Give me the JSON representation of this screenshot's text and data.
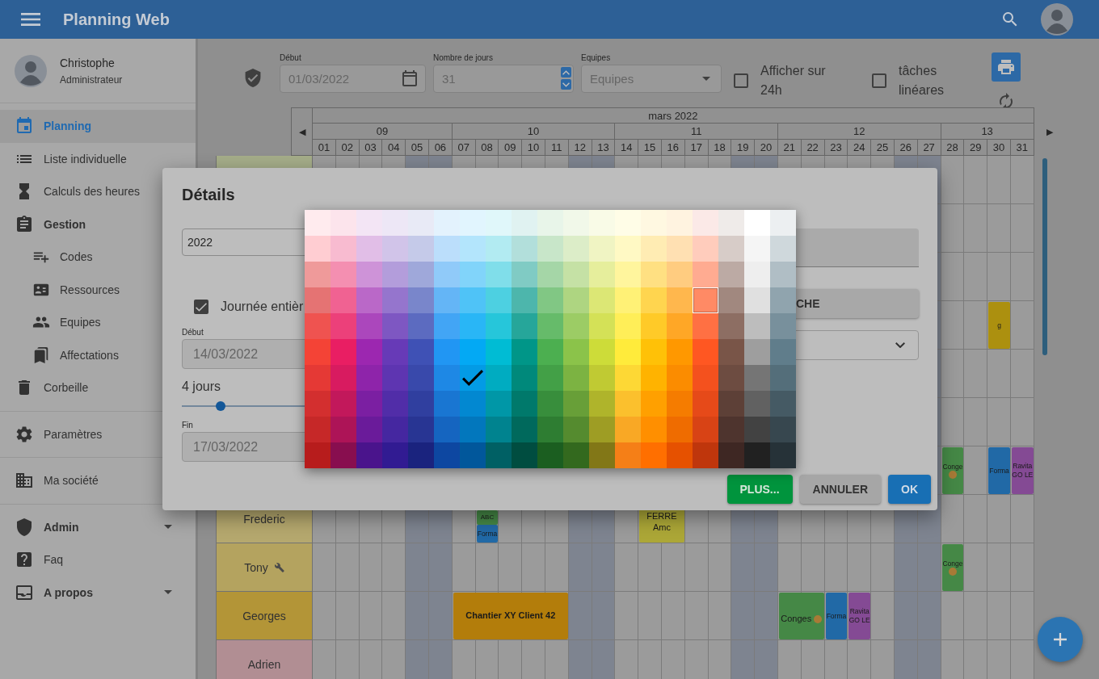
{
  "app_bar": {
    "title": "Planning Web"
  },
  "user": {
    "name": "Christophe",
    "role": "Administrateur"
  },
  "sidebar": {
    "sections": [
      {
        "items": [
          {
            "label": "Planning",
            "kind": "item",
            "selected": true
          },
          {
            "label": "Liste individuelle",
            "kind": "item",
            "selected": false
          },
          {
            "label": "Calculs des heures",
            "kind": "item",
            "selected": false
          },
          {
            "label": "Gestion",
            "kind": "group",
            "selected": false,
            "children": [
              {
                "label": "Codes",
                "kind": "item",
                "selected": false
              },
              {
                "label": "Ressources",
                "kind": "item",
                "selected": false
              },
              {
                "label": "Equipes",
                "kind": "item",
                "selected": false
              },
              {
                "label": "Affectations",
                "kind": "item",
                "selected": false
              }
            ]
          },
          {
            "label": "Corbeille",
            "kind": "item",
            "selected": false
          }
        ]
      },
      {
        "items": [
          {
            "label": "Paramètres",
            "kind": "item",
            "selected": false
          }
        ]
      },
      {
        "items": [
          {
            "label": "Ma société",
            "kind": "item",
            "selected": false
          }
        ]
      },
      {
        "items": [
          {
            "label": "Admin",
            "kind": "menu",
            "selected": false,
            "expanded": false
          },
          {
            "label": "Faq",
            "kind": "item",
            "selected": false
          },
          {
            "label": "A propos",
            "kind": "menu",
            "selected": false,
            "expanded": false
          }
        ]
      }
    ]
  },
  "toolbar": {
    "start_label": "Début",
    "start_value": "01/03/2022",
    "days_label": "Nombre de jours",
    "days_value": "31",
    "teams_label": "Equipes",
    "teams_placeholder": "Equipes",
    "checkboxes": [
      {
        "label": "Afficher sur 24h",
        "checked": false
      },
      {
        "label": "tâches linéares",
        "checked": false
      }
    ]
  },
  "calendar": {
    "month": "mars 2022",
    "prev": "◀",
    "next": "▶",
    "weeks": [
      {
        "label": "09",
        "days": [
          {
            "label": "01",
            "weekend": false
          },
          {
            "label": "02",
            "weekend": false
          },
          {
            "label": "03",
            "weekend": false
          },
          {
            "label": "04",
            "weekend": false
          },
          {
            "label": "05",
            "weekend": true
          },
          {
            "label": "06",
            "weekend": true
          }
        ]
      },
      {
        "label": "10",
        "days": [
          {
            "label": "07",
            "weekend": false
          },
          {
            "label": "08",
            "weekend": false
          },
          {
            "label": "09",
            "weekend": false
          },
          {
            "label": "10",
            "weekend": false
          },
          {
            "label": "11",
            "weekend": false
          },
          {
            "label": "12",
            "weekend": true
          },
          {
            "label": "13",
            "weekend": true
          }
        ]
      },
      {
        "label": "11",
        "days": [
          {
            "label": "14",
            "weekend": false
          },
          {
            "label": "15",
            "weekend": false
          },
          {
            "label": "16",
            "weekend": false
          },
          {
            "label": "17",
            "weekend": false
          },
          {
            "label": "18",
            "weekend": false
          },
          {
            "label": "19",
            "weekend": true
          },
          {
            "label": "20",
            "weekend": true
          }
        ]
      },
      {
        "label": "12",
        "days": [
          {
            "label": "21",
            "weekend": false
          },
          {
            "label": "22",
            "weekend": false
          },
          {
            "label": "23",
            "weekend": false
          },
          {
            "label": "24",
            "weekend": false
          },
          {
            "label": "25",
            "weekend": false
          },
          {
            "label": "26",
            "weekend": true
          },
          {
            "label": "27",
            "weekend": true
          }
        ]
      },
      {
        "label": "13",
        "days": [
          {
            "label": "28",
            "weekend": false
          },
          {
            "label": "29",
            "weekend": false
          },
          {
            "label": "30",
            "weekend": false
          },
          {
            "label": "31",
            "weekend": false
          }
        ]
      }
    ],
    "rows": [
      {
        "color": "#a5ad89"
      },
      {},
      {},
      {
        "timeline": [
          {
            "kind": "empty"
          },
          {
            "kind": "empty"
          },
          {
            "kind": "empty"
          },
          {
            "kind": "empty"
          },
          {
            "kind": "empty"
          },
          {
            "kind": "empty"
          },
          {
            "kind": "empty"
          },
          {
            "kind": "empty"
          },
          {
            "kind": "empty"
          },
          {
            "kind": "empty"
          },
          {
            "kind": "empty"
          },
          {
            "kind": "empty"
          },
          {
            "kind": "empty"
          },
          {
            "kind": "empty"
          },
          {
            "kind": "empty"
          },
          {
            "kind": "empty"
          },
          {
            "kind": "empty"
          },
          {
            "kind": "empty"
          },
          {
            "kind": "empty"
          },
          {
            "kind": "empty"
          },
          {
            "kind": "empty"
          },
          {
            "kind": "empty"
          },
          {
            "kind": "empty"
          },
          {
            "kind": "empty"
          },
          {
            "kind": "empty"
          },
          {
            "kind": "empty"
          },
          {
            "kind": "empty"
          },
          {
            "kind": "empty"
          },
          {
            "kind": "empty"
          },
          {
            "kind": "event",
            "text": "g",
            "color": "#ac900f",
            "emoji": false
          }
        ]
      },
      {},
      {},
      {
        "timeline": [
          {
            "kind": "empty"
          },
          {
            "kind": "empty"
          },
          {
            "kind": "empty"
          },
          {
            "kind": "empty"
          },
          {
            "kind": "empty"
          },
          {
            "kind": "empty"
          },
          {
            "kind": "empty"
          },
          {
            "kind": "empty"
          },
          {
            "kind": "empty"
          },
          {
            "kind": "empty"
          },
          {
            "kind": "empty"
          },
          {
            "kind": "empty"
          },
          {
            "kind": "empty"
          },
          {
            "kind": "empty"
          },
          {
            "kind": "empty"
          },
          {
            "kind": "empty"
          },
          {
            "kind": "empty"
          },
          {
            "kind": "empty"
          },
          {
            "kind": "empty"
          },
          {
            "kind": "empty"
          },
          {
            "kind": "empty"
          },
          {
            "kind": "empty"
          },
          {
            "kind": "empty"
          },
          {
            "kind": "empty"
          },
          {
            "kind": "empty"
          },
          {
            "kind": "empty"
          },
          {
            "kind": "empty"
          },
          {
            "kind": "event",
            "text": "Conge",
            "color": "#458846",
            "emoji": true
          },
          {
            "kind": "empty"
          },
          {
            "kind": "event",
            "text": "Forma",
            "color": "#2169a6",
            "emoji": false
          },
          {
            "kind": "event",
            "text": "Ravita GO LE",
            "color": "#844a94",
            "emoji": false
          }
        ]
      },
      {
        "name": "Frederic",
        "color": "#b5a86e",
        "has_icon": false,
        "timeline": [
          {
            "kind": "empty"
          },
          {
            "kind": "empty"
          },
          {
            "kind": "empty"
          },
          {
            "kind": "empty"
          },
          {
            "kind": "empty"
          },
          {
            "kind": "empty"
          },
          {
            "kind": "empty"
          },
          {
            "kind": "stack",
            "events": [
              {
                "text": "ABC",
                "color": "#458846",
                "emoji": false
              },
              {
                "text": "Forma",
                "color": "#2169a6",
                "emoji": false
              }
            ]
          },
          {
            "kind": "empty"
          },
          {
            "kind": "empty"
          },
          {
            "kind": "empty"
          },
          {
            "kind": "empty"
          },
          {
            "kind": "empty"
          },
          {
            "kind": "empty"
          },
          {
            "kind": "event",
            "text": "FERRE Amc",
            "color": "#aca737",
            "emoji": false
          },
          {
            "kind": "continued"
          }
        ]
      },
      {
        "name": "Tony",
        "color": "#b4a35f",
        "has_icon": true,
        "timeline": [
          {
            "kind": "empty"
          },
          {
            "kind": "empty"
          },
          {
            "kind": "empty"
          },
          {
            "kind": "empty"
          },
          {
            "kind": "empty"
          },
          {
            "kind": "empty"
          },
          {
            "kind": "empty"
          },
          {
            "kind": "empty"
          },
          {
            "kind": "empty"
          },
          {
            "kind": "empty"
          },
          {
            "kind": "empty"
          },
          {
            "kind": "empty"
          },
          {
            "kind": "empty"
          },
          {
            "kind": "empty"
          },
          {
            "kind": "empty"
          },
          {
            "kind": "empty"
          },
          {
            "kind": "empty"
          },
          {
            "kind": "empty"
          },
          {
            "kind": "empty"
          },
          {
            "kind": "empty"
          },
          {
            "kind": "empty"
          },
          {
            "kind": "empty"
          },
          {
            "kind": "empty"
          },
          {
            "kind": "empty"
          },
          {
            "kind": "empty"
          },
          {
            "kind": "empty"
          },
          {
            "kind": "empty"
          },
          {
            "kind": "event",
            "text": "Conge",
            "color": "#458846",
            "emoji": true
          }
        ]
      },
      {
        "name": "Georges",
        "color": "#b39537",
        "has_icon": false,
        "timeline": [
          {
            "kind": "empty"
          },
          {
            "kind": "empty"
          },
          {
            "kind": "empty"
          },
          {
            "kind": "empty"
          },
          {
            "kind": "empty"
          },
          {
            "kind": "empty"
          },
          {
            "kind": "event",
            "text": "Chantier XY Client 42",
            "color": "#b37d0b",
            "emoji": false
          },
          {
            "kind": "continued"
          },
          {
            "kind": "continued"
          },
          {
            "kind": "continued"
          },
          {
            "kind": "continued"
          },
          {
            "kind": "empty"
          },
          {
            "kind": "empty"
          },
          {
            "kind": "empty"
          },
          {
            "kind": "empty"
          },
          {
            "kind": "empty"
          },
          {
            "kind": "empty"
          },
          {
            "kind": "empty"
          },
          {
            "kind": "empty"
          },
          {
            "kind": "empty"
          },
          {
            "kind": "event",
            "text": "Conges",
            "color": "#458846",
            "emoji": true
          },
          {
            "kind": "continued"
          },
          {
            "kind": "event",
            "text": "Forma",
            "color": "#2169a6",
            "emoji": false
          },
          {
            "kind": "event",
            "text": "Ravita GO LE",
            "color": "#844a94",
            "emoji": false
          }
        ]
      },
      {
        "name": "Adrien",
        "color": "#b18e93",
        "has_icon": false
      }
    ]
  },
  "dialog": {
    "title": "Détails",
    "name_value": "2022",
    "all_day": {
      "label": "Journée entièr",
      "checked": true
    },
    "start_label": "Début",
    "start_value": "14/03/2022",
    "duration": {
      "label": "4 jours",
      "level": 0.12
    },
    "end_label": "Fin",
    "end_value": "17/03/2022",
    "side_button": "CHE",
    "buttons": [
      {
        "label": "PLUS...",
        "kind": "more"
      },
      {
        "label": "ANNULER",
        "kind": "cancel"
      },
      {
        "label": "OK",
        "kind": "ok"
      }
    ]
  },
  "palette": {
    "rows": [
      {
        "swatches": [
          {
            "color": "#ffebee",
            "selected": false,
            "hovered": false
          },
          {
            "color": "#fce4ec",
            "selected": false,
            "hovered": false
          },
          {
            "color": "#f3e5f5",
            "selected": false,
            "hovered": false
          },
          {
            "color": "#ede7f6",
            "selected": false,
            "hovered": false
          },
          {
            "color": "#e8eaf6",
            "selected": false,
            "hovered": false
          },
          {
            "color": "#e3f2fd",
            "selected": false,
            "hovered": false
          },
          {
            "color": "#e1f5fe",
            "selected": false,
            "hovered": false
          },
          {
            "color": "#e0f7fa",
            "selected": false,
            "hovered": false
          },
          {
            "color": "#e0f2f1",
            "selected": false,
            "hovered": false
          },
          {
            "color": "#e8f5e9",
            "selected": false,
            "hovered": false
          },
          {
            "color": "#f1f8e9",
            "selected": false,
            "hovered": false
          },
          {
            "color": "#f9fbe7",
            "selected": false,
            "hovered": false
          },
          {
            "color": "#fffde7",
            "selected": false,
            "hovered": false
          },
          {
            "color": "#fff8e1",
            "selected": false,
            "hovered": false
          },
          {
            "color": "#fff3e0",
            "selected": false,
            "hovered": false
          },
          {
            "color": "#fbe9e7",
            "selected": false,
            "hovered": false
          },
          {
            "color": "#efebe9",
            "selected": false,
            "hovered": false
          },
          {
            "color": "#ffffff",
            "selected": false,
            "hovered": false
          },
          {
            "color": "#eceff1",
            "selected": false,
            "hovered": false
          }
        ]
      },
      {
        "swatches": [
          {
            "color": "#ffcdd2",
            "selected": false,
            "hovered": false
          },
          {
            "color": "#f8bbd0",
            "selected": false,
            "hovered": false
          },
          {
            "color": "#e1bee7",
            "selected": false,
            "hovered": false
          },
          {
            "color": "#d1c4e9",
            "selected": false,
            "hovered": false
          },
          {
            "color": "#c5cae9",
            "selected": false,
            "hovered": false
          },
          {
            "color": "#bbdefb",
            "selected": false,
            "hovered": false
          },
          {
            "color": "#b3e5fc",
            "selected": false,
            "hovered": false
          },
          {
            "color": "#b2ebf2",
            "selected": false,
            "hovered": false
          },
          {
            "color": "#b2dfdb",
            "selected": false,
            "hovered": false
          },
          {
            "color": "#c8e6c9",
            "selected": false,
            "hovered": false
          },
          {
            "color": "#dcedc8",
            "selected": false,
            "hovered": false
          },
          {
            "color": "#f0f4c3",
            "selected": false,
            "hovered": false
          },
          {
            "color": "#fff9c4",
            "selected": false,
            "hovered": false
          },
          {
            "color": "#ffecb3",
            "selected": false,
            "hovered": false
          },
          {
            "color": "#ffe0b2",
            "selected": false,
            "hovered": false
          },
          {
            "color": "#ffccbc",
            "selected": false,
            "hovered": false
          },
          {
            "color": "#d7ccc8",
            "selected": false,
            "hovered": false
          },
          {
            "color": "#f5f5f5",
            "selected": false,
            "hovered": false
          },
          {
            "color": "#cfd8dc",
            "selected": false,
            "hovered": false
          }
        ]
      },
      {
        "swatches": [
          {
            "color": "#ef9a9a",
            "selected": false,
            "hovered": false
          },
          {
            "color": "#f48fb1",
            "selected": false,
            "hovered": false
          },
          {
            "color": "#ce93d8",
            "selected": false,
            "hovered": false
          },
          {
            "color": "#b39ddb",
            "selected": false,
            "hovered": false
          },
          {
            "color": "#9fa8da",
            "selected": false,
            "hovered": false
          },
          {
            "color": "#90caf9",
            "selected": false,
            "hovered": false
          },
          {
            "color": "#81d4fa",
            "selected": false,
            "hovered": false
          },
          {
            "color": "#80deea",
            "selected": false,
            "hovered": false
          },
          {
            "color": "#80cbc4",
            "selected": false,
            "hovered": false
          },
          {
            "color": "#a5d6a7",
            "selected": false,
            "hovered": false
          },
          {
            "color": "#c5e1a5",
            "selected": false,
            "hovered": false
          },
          {
            "color": "#e6ee9c",
            "selected": false,
            "hovered": false
          },
          {
            "color": "#fff59d",
            "selected": false,
            "hovered": false
          },
          {
            "color": "#ffe082",
            "selected": false,
            "hovered": false
          },
          {
            "color": "#ffcc80",
            "selected": false,
            "hovered": false
          },
          {
            "color": "#ffab91",
            "selected": false,
            "hovered": false
          },
          {
            "color": "#bcaaa4",
            "selected": false,
            "hovered": false
          },
          {
            "color": "#eeeeee",
            "selected": false,
            "hovered": false
          },
          {
            "color": "#b0bec5",
            "selected": false,
            "hovered": false
          }
        ]
      },
      {
        "swatches": [
          {
            "color": "#e57373",
            "selected": false,
            "hovered": false
          },
          {
            "color": "#f06292",
            "selected": false,
            "hovered": false
          },
          {
            "color": "#ba68c8",
            "selected": false,
            "hovered": false
          },
          {
            "color": "#9575cd",
            "selected": false,
            "hovered": false
          },
          {
            "color": "#7986cb",
            "selected": false,
            "hovered": false
          },
          {
            "color": "#64b5f6",
            "selected": false,
            "hovered": false
          },
          {
            "color": "#4fc3f7",
            "selected": false,
            "hovered": false
          },
          {
            "color": "#4dd0e1",
            "selected": false,
            "hovered": false
          },
          {
            "color": "#4db6ac",
            "selected": false,
            "hovered": false
          },
          {
            "color": "#81c784",
            "selected": false,
            "hovered": false
          },
          {
            "color": "#aed581",
            "selected": false,
            "hovered": false
          },
          {
            "color": "#dce775",
            "selected": false,
            "hovered": false
          },
          {
            "color": "#fff176",
            "selected": false,
            "hovered": false
          },
          {
            "color": "#ffd54f",
            "selected": false,
            "hovered": false
          },
          {
            "color": "#ffb74d",
            "selected": false,
            "hovered": false
          },
          {
            "color": "#ff8a65",
            "selected": false,
            "hovered": true
          },
          {
            "color": "#a1887f",
            "selected": false,
            "hovered": false
          },
          {
            "color": "#e0e0e0",
            "selected": false,
            "hovered": false
          },
          {
            "color": "#90a4ae",
            "selected": false,
            "hovered": false
          }
        ]
      },
      {
        "swatches": [
          {
            "color": "#ef5350",
            "selected": false,
            "hovered": false
          },
          {
            "color": "#ec407a",
            "selected": false,
            "hovered": false
          },
          {
            "color": "#ab47bc",
            "selected": false,
            "hovered": false
          },
          {
            "color": "#7e57c2",
            "selected": false,
            "hovered": false
          },
          {
            "color": "#5c6bc0",
            "selected": false,
            "hovered": false
          },
          {
            "color": "#42a5f5",
            "selected": false,
            "hovered": false
          },
          {
            "color": "#29b6f6",
            "selected": false,
            "hovered": false
          },
          {
            "color": "#26c6da",
            "selected": false,
            "hovered": false
          },
          {
            "color": "#26a69a",
            "selected": false,
            "hovered": false
          },
          {
            "color": "#66bb6a",
            "selected": false,
            "hovered": false
          },
          {
            "color": "#9ccc65",
            "selected": false,
            "hovered": false
          },
          {
            "color": "#d4e157",
            "selected": false,
            "hovered": false
          },
          {
            "color": "#ffee58",
            "selected": false,
            "hovered": false
          },
          {
            "color": "#ffca28",
            "selected": false,
            "hovered": false
          },
          {
            "color": "#ffa726",
            "selected": false,
            "hovered": false
          },
          {
            "color": "#ff7043",
            "selected": false,
            "hovered": false
          },
          {
            "color": "#8d6e63",
            "selected": false,
            "hovered": false
          },
          {
            "color": "#bdbdbd",
            "selected": false,
            "hovered": false
          },
          {
            "color": "#78909c",
            "selected": false,
            "hovered": false
          }
        ]
      },
      {
        "swatches": [
          {
            "color": "#f44336",
            "selected": false,
            "hovered": false
          },
          {
            "color": "#e91e63",
            "selected": false,
            "hovered": false
          },
          {
            "color": "#9c27b0",
            "selected": false,
            "hovered": false
          },
          {
            "color": "#673ab7",
            "selected": false,
            "hovered": false
          },
          {
            "color": "#3f51b5",
            "selected": false,
            "hovered": false
          },
          {
            "color": "#2196f3",
            "selected": false,
            "hovered": false
          },
          {
            "color": "#03a9f4",
            "selected": false,
            "hovered": false
          },
          {
            "color": "#00bcd4",
            "selected": false,
            "hovered": false
          },
          {
            "color": "#009688",
            "selected": false,
            "hovered": false
          },
          {
            "color": "#4caf50",
            "selected": false,
            "hovered": false
          },
          {
            "color": "#8bc34a",
            "selected": false,
            "hovered": false
          },
          {
            "color": "#cddc39",
            "selected": false,
            "hovered": false
          },
          {
            "color": "#ffeb3b",
            "selected": false,
            "hovered": false
          },
          {
            "color": "#ffc107",
            "selected": false,
            "hovered": false
          },
          {
            "color": "#ff9800",
            "selected": false,
            "hovered": false
          },
          {
            "color": "#ff5722",
            "selected": false,
            "hovered": false
          },
          {
            "color": "#795548",
            "selected": false,
            "hovered": false
          },
          {
            "color": "#9e9e9e",
            "selected": false,
            "hovered": false
          },
          {
            "color": "#607d8b",
            "selected": false,
            "hovered": false
          }
        ]
      },
      {
        "swatches": [
          {
            "color": "#e53935",
            "selected": false,
            "hovered": false
          },
          {
            "color": "#d81b60",
            "selected": false,
            "hovered": false
          },
          {
            "color": "#8e24aa",
            "selected": false,
            "hovered": false
          },
          {
            "color": "#5e35b1",
            "selected": false,
            "hovered": false
          },
          {
            "color": "#3949ab",
            "selected": false,
            "hovered": false
          },
          {
            "color": "#1e88e5",
            "selected": false,
            "hovered": false
          },
          {
            "color": "#039be5",
            "selected": true,
            "hovered": false
          },
          {
            "color": "#00acc1",
            "selected": false,
            "hovered": false
          },
          {
            "color": "#00897b",
            "selected": false,
            "hovered": false
          },
          {
            "color": "#43a047",
            "selected": false,
            "hovered": false
          },
          {
            "color": "#7cb342",
            "selected": false,
            "hovered": false
          },
          {
            "color": "#c0ca33",
            "selected": false,
            "hovered": false
          },
          {
            "color": "#fdd835",
            "selected": false,
            "hovered": false
          },
          {
            "color": "#ffb300",
            "selected": false,
            "hovered": false
          },
          {
            "color": "#fb8c00",
            "selected": false,
            "hovered": false
          },
          {
            "color": "#f4511e",
            "selected": false,
            "hovered": false
          },
          {
            "color": "#6d4c41",
            "selected": false,
            "hovered": false
          },
          {
            "color": "#757575",
            "selected": false,
            "hovered": false
          },
          {
            "color": "#546e7a",
            "selected": false,
            "hovered": false
          }
        ]
      },
      {
        "swatches": [
          {
            "color": "#d32f2f",
            "selected": false,
            "hovered": false
          },
          {
            "color": "#c2185b",
            "selected": false,
            "hovered": false
          },
          {
            "color": "#7b1fa2",
            "selected": false,
            "hovered": false
          },
          {
            "color": "#512da8",
            "selected": false,
            "hovered": false
          },
          {
            "color": "#303f9f",
            "selected": false,
            "hovered": false
          },
          {
            "color": "#1976d2",
            "selected": false,
            "hovered": false
          },
          {
            "color": "#0288d1",
            "selected": false,
            "hovered": false
          },
          {
            "color": "#0097a7",
            "selected": false,
            "hovered": false
          },
          {
            "color": "#00796b",
            "selected": false,
            "hovered": false
          },
          {
            "color": "#388e3c",
            "selected": false,
            "hovered": false
          },
          {
            "color": "#689f38",
            "selected": false,
            "hovered": false
          },
          {
            "color": "#afb42b",
            "selected": false,
            "hovered": false
          },
          {
            "color": "#fbc02d",
            "selected": false,
            "hovered": false
          },
          {
            "color": "#ffa000",
            "selected": false,
            "hovered": false
          },
          {
            "color": "#f57c00",
            "selected": false,
            "hovered": false
          },
          {
            "color": "#e64a19",
            "selected": false,
            "hovered": false
          },
          {
            "color": "#5d4037",
            "selected": false,
            "hovered": false
          },
          {
            "color": "#616161",
            "selected": false,
            "hovered": false
          },
          {
            "color": "#455a64",
            "selected": false,
            "hovered": false
          }
        ]
      },
      {
        "swatches": [
          {
            "color": "#c62828",
            "selected": false,
            "hovered": false
          },
          {
            "color": "#ad1457",
            "selected": false,
            "hovered": false
          },
          {
            "color": "#6a1b9a",
            "selected": false,
            "hovered": false
          },
          {
            "color": "#4527a0",
            "selected": false,
            "hovered": false
          },
          {
            "color": "#283593",
            "selected": false,
            "hovered": false
          },
          {
            "color": "#1565c0",
            "selected": false,
            "hovered": false
          },
          {
            "color": "#0277bd",
            "selected": false,
            "hovered": false
          },
          {
            "color": "#00838f",
            "selected": false,
            "hovered": false
          },
          {
            "color": "#00695c",
            "selected": false,
            "hovered": false
          },
          {
            "color": "#2e7d32",
            "selected": false,
            "hovered": false
          },
          {
            "color": "#558b2f",
            "selected": false,
            "hovered": false
          },
          {
            "color": "#9e9d24",
            "selected": false,
            "hovered": false
          },
          {
            "color": "#f9a825",
            "selected": false,
            "hovered": false
          },
          {
            "color": "#ff8f00",
            "selected": false,
            "hovered": false
          },
          {
            "color": "#ef6c00",
            "selected": false,
            "hovered": false
          },
          {
            "color": "#d84315",
            "selected": false,
            "hovered": false
          },
          {
            "color": "#4e342e",
            "selected": false,
            "hovered": false
          },
          {
            "color": "#424242",
            "selected": false,
            "hovered": false
          },
          {
            "color": "#37474f",
            "selected": false,
            "hovered": false
          }
        ]
      },
      {
        "swatches": [
          {
            "color": "#b71c1c",
            "selected": false,
            "hovered": false
          },
          {
            "color": "#880e4f",
            "selected": false,
            "hovered": false
          },
          {
            "color": "#4a148c",
            "selected": false,
            "hovered": false
          },
          {
            "color": "#311b92",
            "selected": false,
            "hovered": false
          },
          {
            "color": "#1a237e",
            "selected": false,
            "hovered": false
          },
          {
            "color": "#0d47a1",
            "selected": false,
            "hovered": false
          },
          {
            "color": "#01579b",
            "selected": false,
            "hovered": false
          },
          {
            "color": "#006064",
            "selected": false,
            "hovered": false
          },
          {
            "color": "#004d40",
            "selected": false,
            "hovered": false
          },
          {
            "color": "#1b5e20",
            "selected": false,
            "hovered": false
          },
          {
            "color": "#33691e",
            "selected": false,
            "hovered": false
          },
          {
            "color": "#827717",
            "selected": false,
            "hovered": false
          },
          {
            "color": "#f57f17",
            "selected": false,
            "hovered": false
          },
          {
            "color": "#ff6f00",
            "selected": false,
            "hovered": false
          },
          {
            "color": "#e65100",
            "selected": false,
            "hovered": false
          },
          {
            "color": "#bf360c",
            "selected": false,
            "hovered": false
          },
          {
            "color": "#3e2723",
            "selected": false,
            "hovered": false
          },
          {
            "color": "#212121",
            "selected": false,
            "hovered": false
          },
          {
            "color": "#263238",
            "selected": false,
            "hovered": false
          }
        ]
      }
    ]
  }
}
